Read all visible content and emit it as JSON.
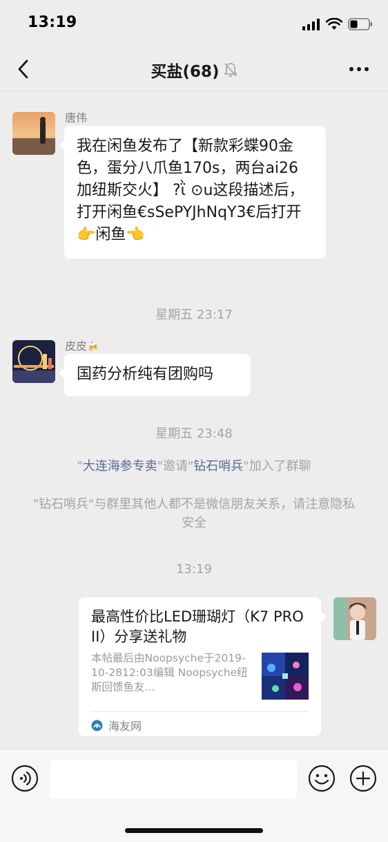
{
  "status_bar": {
    "time": "13:19"
  },
  "nav": {
    "title": "买盐(68)"
  },
  "messages": [
    {
      "sender": "唐伟",
      "text": "我在闲鱼发布了【新款彩蝶90金色，蛋分八爪鱼170s，两台ai26加纽斯交火】 ?ῒ ⊙u这段描述后，打开闲鱼€sSePYJhNqY3€后打开👉闲鱼👈"
    },
    {
      "time": "星期五 23:17"
    },
    {
      "sender": "皮皮",
      "sender_emoji": "🍻",
      "text": "国药分析纯有团购吗"
    },
    {
      "time": "星期五 23:48"
    }
  ],
  "system_notices": {
    "invite": {
      "inviter": "大连海参专卖",
      "verb": "邀请",
      "invitee": "钻石哨兵",
      "suffix": "加入了群聊"
    },
    "privacy": "\"钻石哨兵\"与群里其他人都不是微信朋友关系，请注意隐私安全"
  },
  "last_time": "13:19",
  "link_card": {
    "title": "最高性价比LED珊瑚灯（K7 PRO II）分享送礼物",
    "description": "本帖最后由Noopsyche于2019-10-2812:03编辑 Noopsyche纽斯回馈鱼友...",
    "source": "海友网"
  },
  "colors": {
    "link": "#576b95",
    "muted": "#a4a4a4",
    "background": "#ededed",
    "bubble": "#ffffff"
  },
  "icons": [
    "back-icon",
    "mute-bell-icon",
    "more-icon",
    "voice-icon",
    "emoji-icon",
    "plus-icon",
    "site-logo-icon"
  ]
}
